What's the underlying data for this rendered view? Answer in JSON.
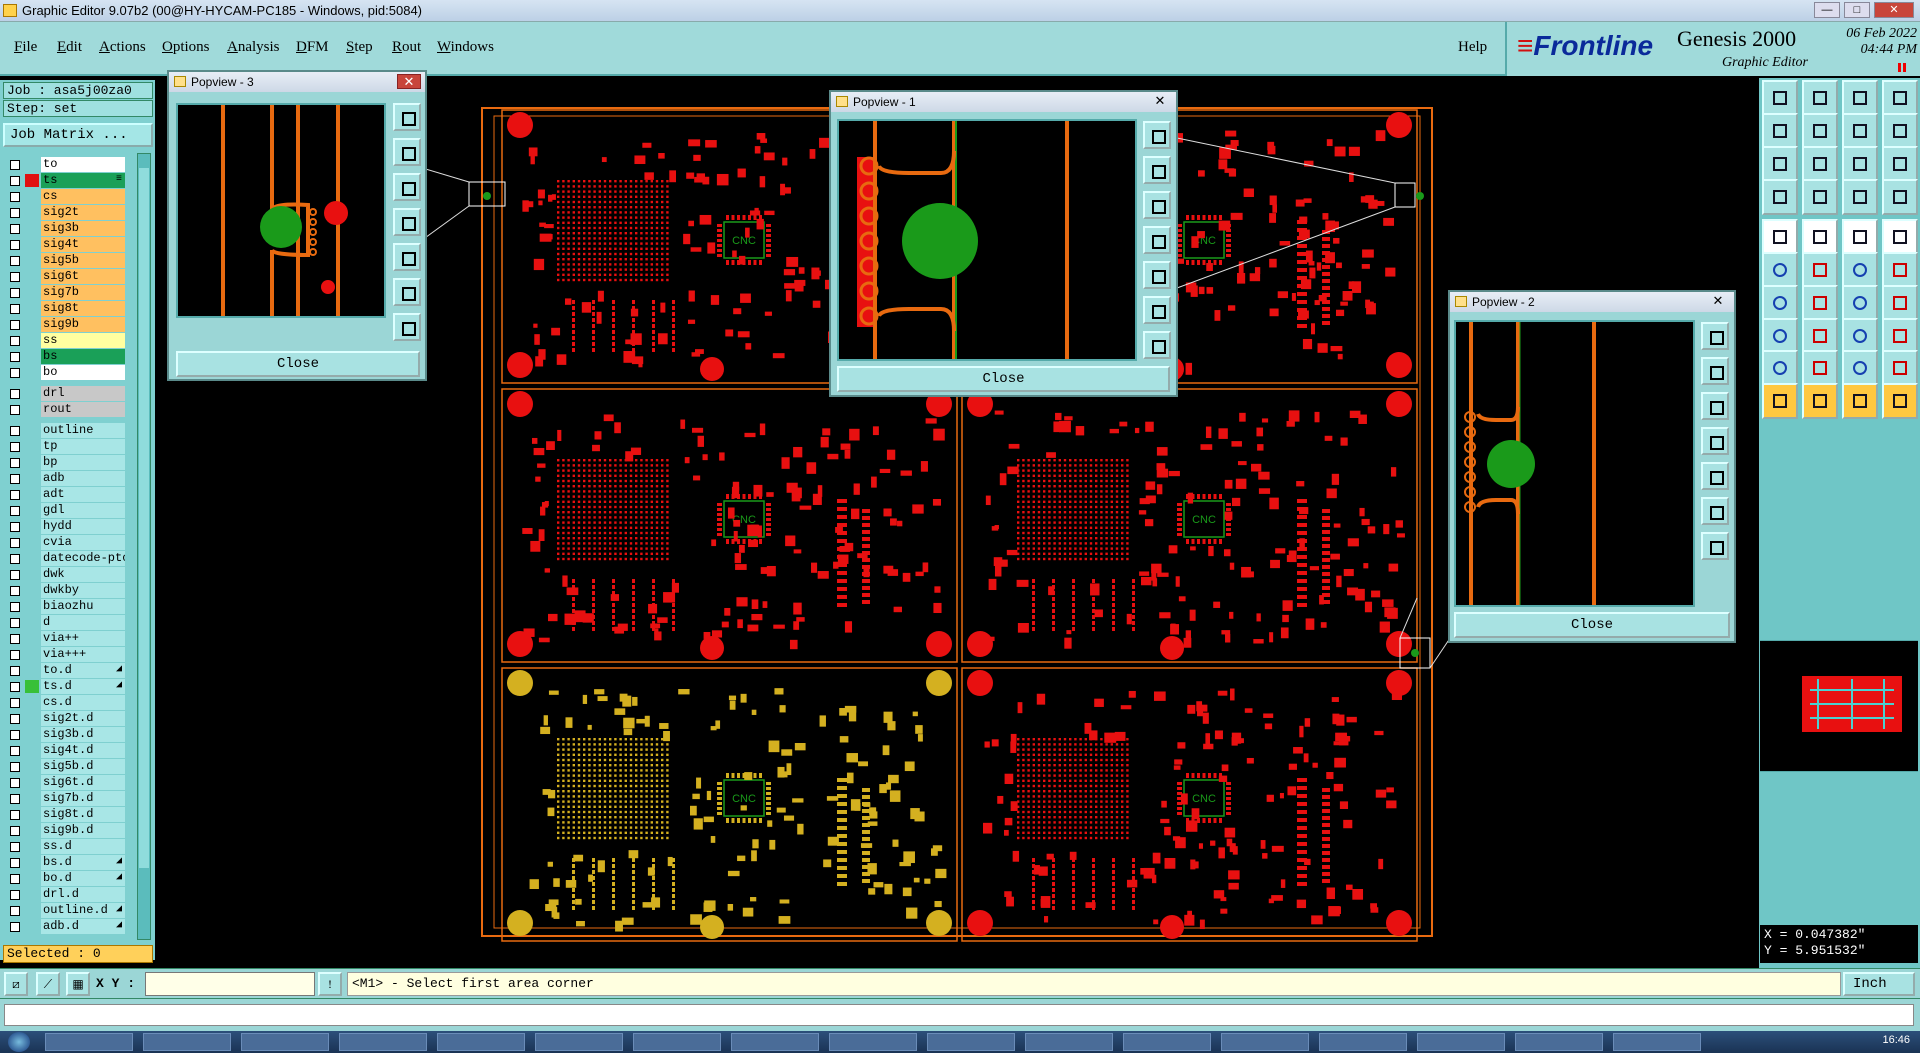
{
  "window": {
    "title": "Graphic Editor 9.07b2 (00@HY-HYCAM-PC185 - Windows, pid:5084)",
    "controls": [
      "—",
      "□",
      "✕"
    ]
  },
  "menu": {
    "items": [
      {
        "key": "F",
        "rest": "ile"
      },
      {
        "key": "E",
        "rest": "dit"
      },
      {
        "key": "A",
        "rest": "ctions"
      },
      {
        "key": "O",
        "rest": "ptions"
      },
      {
        "key": "A",
        "rest": "nalysis"
      },
      {
        "key": "D",
        "rest": "FM"
      },
      {
        "key": "S",
        "rest": "tep"
      },
      {
        "key": "R",
        "rest": "out"
      },
      {
        "key": "W",
        "rest": "indows"
      }
    ],
    "help": "Help"
  },
  "brand": {
    "logo": "Frontline",
    "product": "Genesis 2000",
    "subtitle": "Graphic Editor",
    "date": "06 Feb 2022",
    "time": "04:44 PM"
  },
  "job": {
    "job_label": "Job : asa5j00za0",
    "step_label": "Step: set",
    "matrix_button": "Job Matrix ..."
  },
  "layers": [
    {
      "name": "to",
      "color": "#ffffff",
      "swatch": "",
      "ind": ""
    },
    {
      "name": "ts",
      "color": "#1aa058",
      "swatch": "#e01010",
      "ind": "≡"
    },
    {
      "name": "cs",
      "color": "#ffc060",
      "swatch": "",
      "ind": ""
    },
    {
      "name": "sig2t",
      "color": "#ffc060",
      "swatch": "",
      "ind": ""
    },
    {
      "name": "sig3b",
      "color": "#ffc060",
      "swatch": "",
      "ind": ""
    },
    {
      "name": "sig4t",
      "color": "#ffc060",
      "swatch": "",
      "ind": ""
    },
    {
      "name": "sig5b",
      "color": "#ffc060",
      "swatch": "",
      "ind": ""
    },
    {
      "name": "sig6t",
      "color": "#ffc060",
      "swatch": "",
      "ind": ""
    },
    {
      "name": "sig7b",
      "color": "#ffc060",
      "swatch": "",
      "ind": ""
    },
    {
      "name": "sig8t",
      "color": "#ffc060",
      "swatch": "",
      "ind": ""
    },
    {
      "name": "sig9b",
      "color": "#ffc060",
      "swatch": "",
      "ind": ""
    },
    {
      "name": "ss",
      "color": "#ffffa0",
      "swatch": "",
      "ind": ""
    },
    {
      "name": "bs",
      "color": "#1aa058",
      "swatch": "",
      "ind": ""
    },
    {
      "name": "bo",
      "color": "#ffffff",
      "swatch": "",
      "ind": ""
    },
    {
      "name": "drl",
      "color": "#c8c8c8",
      "swatch": "",
      "ind": ""
    },
    {
      "name": "rout",
      "color": "#c8c8c8",
      "swatch": "",
      "ind": ""
    },
    {
      "name": "outline",
      "color": "#a8e6e6",
      "swatch": "",
      "ind": ""
    },
    {
      "name": "tp",
      "color": "#a8e6e6",
      "swatch": "",
      "ind": ""
    },
    {
      "name": "bp",
      "color": "#a8e6e6",
      "swatch": "",
      "ind": ""
    },
    {
      "name": "adb",
      "color": "#a8e6e6",
      "swatch": "",
      "ind": ""
    },
    {
      "name": "adt",
      "color": "#a8e6e6",
      "swatch": "",
      "ind": ""
    },
    {
      "name": "gdl",
      "color": "#a8e6e6",
      "swatch": "",
      "ind": ""
    },
    {
      "name": "hydd",
      "color": "#a8e6e6",
      "swatch": "",
      "ind": ""
    },
    {
      "name": "cvia",
      "color": "#a8e6e6",
      "swatch": "",
      "ind": ""
    },
    {
      "name": "datecode-ptc",
      "color": "#a8e6e6",
      "swatch": "",
      "ind": ""
    },
    {
      "name": "dwk",
      "color": "#a8e6e6",
      "swatch": "",
      "ind": ""
    },
    {
      "name": "dwkby",
      "color": "#a8e6e6",
      "swatch": "",
      "ind": ""
    },
    {
      "name": "biaozhu",
      "color": "#a8e6e6",
      "swatch": "",
      "ind": ""
    },
    {
      "name": "d",
      "color": "#a8e6e6",
      "swatch": "",
      "ind": ""
    },
    {
      "name": "via++",
      "color": "#a8e6e6",
      "swatch": "",
      "ind": ""
    },
    {
      "name": "via+++",
      "color": "#a8e6e6",
      "swatch": "",
      "ind": ""
    },
    {
      "name": "to.d",
      "color": "#a8e6e6",
      "swatch": "",
      "ind": "◢"
    },
    {
      "name": "ts.d",
      "color": "#a8e6e6",
      "swatch": "#38c038",
      "ind": "◢"
    },
    {
      "name": "cs.d",
      "color": "#a8e6e6",
      "swatch": "",
      "ind": ""
    },
    {
      "name": "sig2t.d",
      "color": "#a8e6e6",
      "swatch": "",
      "ind": ""
    },
    {
      "name": "sig3b.d",
      "color": "#a8e6e6",
      "swatch": "",
      "ind": ""
    },
    {
      "name": "sig4t.d",
      "color": "#a8e6e6",
      "swatch": "",
      "ind": ""
    },
    {
      "name": "sig5b.d",
      "color": "#a8e6e6",
      "swatch": "",
      "ind": ""
    },
    {
      "name": "sig6t.d",
      "color": "#a8e6e6",
      "swatch": "",
      "ind": ""
    },
    {
      "name": "sig7b.d",
      "color": "#a8e6e6",
      "swatch": "",
      "ind": ""
    },
    {
      "name": "sig8t.d",
      "color": "#a8e6e6",
      "swatch": "",
      "ind": ""
    },
    {
      "name": "sig9b.d",
      "color": "#a8e6e6",
      "swatch": "",
      "ind": ""
    },
    {
      "name": "ss.d",
      "color": "#a8e6e6",
      "swatch": "",
      "ind": ""
    },
    {
      "name": "bs.d",
      "color": "#a8e6e6",
      "swatch": "",
      "ind": "◢"
    },
    {
      "name": "bo.d",
      "color": "#a8e6e6",
      "swatch": "",
      "ind": "◢"
    },
    {
      "name": "drl.d",
      "color": "#a8e6e6",
      "swatch": "",
      "ind": ""
    },
    {
      "name": "outline.d",
      "color": "#a8e6e6",
      "swatch": "",
      "ind": "◢"
    },
    {
      "name": "adb.d",
      "color": "#a8e6e6",
      "swatch": "",
      "ind": "◢"
    }
  ],
  "selected_label": "Selected : 0",
  "popups": [
    {
      "title": "Popview - 3",
      "close": "Close"
    },
    {
      "title": "Popview - 1",
      "close": "Close"
    },
    {
      "title": "Popview - 2",
      "close": "Close"
    }
  ],
  "board": {
    "chip_label": "CNC"
  },
  "coords": {
    "x": "X = 0.047382\"",
    "y": "Y = 5.951532\""
  },
  "command": {
    "xy_label": "X Y :",
    "xy_value": "",
    "prompt": "<M1> - Select first area corner",
    "units": "Inch"
  },
  "taskbar": {
    "clock": "16:46"
  },
  "colors": {
    "panel": "#a0dada",
    "copper": "#e81010",
    "selected_layer": "#d4b020",
    "trace": "#e86a10",
    "pad": "#1a9a1a"
  }
}
